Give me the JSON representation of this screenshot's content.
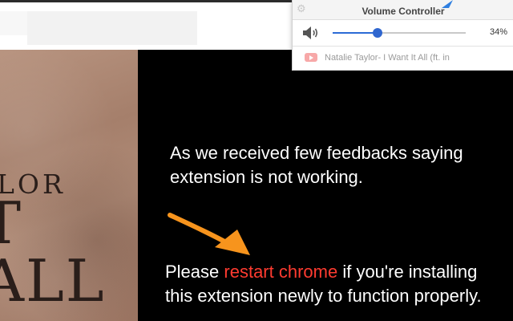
{
  "popup": {
    "title": "Volume Controller",
    "volume_percent": 34,
    "volume_label": "34%",
    "tab_title": "Natalie Taylor- I Want It All (ft. in",
    "icons": {
      "settings": "gear-icon",
      "speaker": "speaker-icon",
      "tab_source": "youtube-icon"
    }
  },
  "artwork": {
    "line1": "LOR",
    "line2": "T ALL"
  },
  "message": {
    "line1": "As we received few feedbacks saying",
    "line2": "extension is not working.",
    "line3_pre": "Please ",
    "line3_highlight": "restart chrome",
    "line3_post": " if you're installing",
    "line4": "this extension newly to function properly."
  },
  "colors": {
    "highlight": "#ff3b30",
    "arrow": "#f7941d",
    "slider": "#2f66cf"
  }
}
